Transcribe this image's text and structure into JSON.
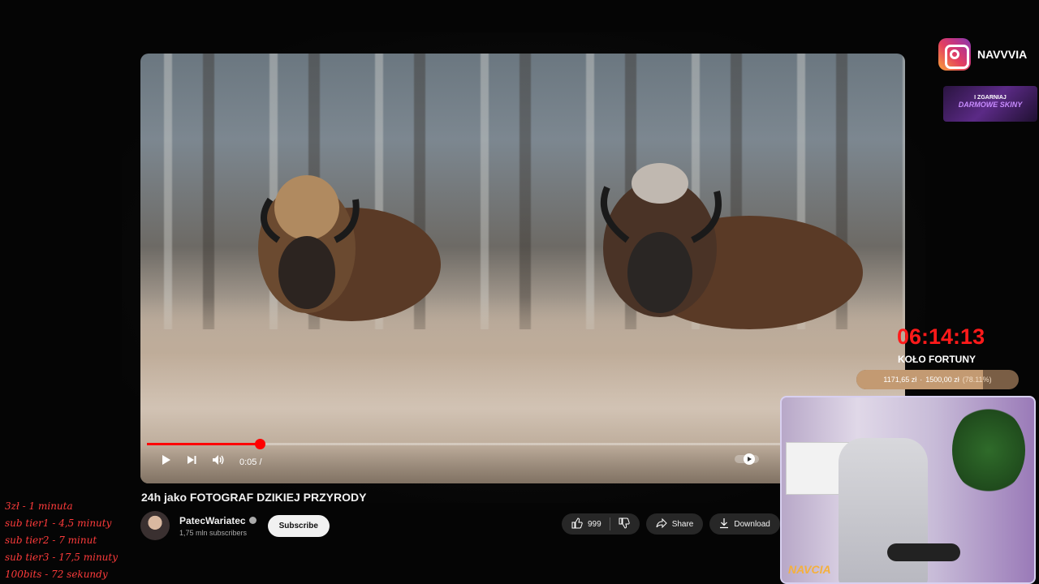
{
  "player": {
    "current_time": "0:05 /",
    "progress_fraction": 0.15
  },
  "video": {
    "title": "24h jako FOTOGRAF DZIKIEJ PRZYRODY",
    "channel_name": "PatecWariatec",
    "subscribers": "1,75 mln subscribers",
    "subscribe_label": "Subscribe",
    "likes": "999",
    "share_label": "Share",
    "download_label": "Download"
  },
  "overlay": {
    "instagram_handle": "NAVVVIA",
    "banner_line1": "I ZGARNIAJ",
    "banner_line2": "DARMOWE SKINY",
    "timer": "06:14:13",
    "wheel_label": "KOŁO FORTUNY",
    "goal_current": "1171,65 zł",
    "goal_sep": "·",
    "goal_target": "1500,00 zł",
    "goal_percent": "(78.11%)",
    "goal_fraction": 0.7811,
    "webcam_logo": "NAVCIA"
  },
  "rules": [
    "3zł - 1 minuta",
    "sub tier1 - 4,5 minuty",
    "sub tier2 - 7 minut",
    "sub tier3 - 17,5 minuty",
    "100bits - 72 sekundy"
  ],
  "colors": {
    "accent_red": "#ff0000",
    "timer_red": "#ff1a1a",
    "rules_red": "#ff3b3b"
  }
}
